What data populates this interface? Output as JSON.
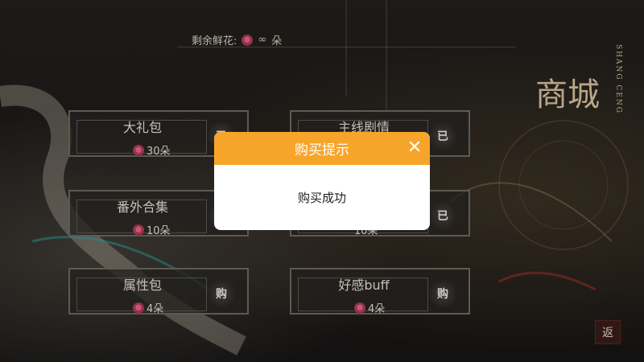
{
  "header": {
    "remaining_label": "剩余鲜花:",
    "remaining_value": "∞",
    "unit": "朵",
    "flower_icon": "flower-icon"
  },
  "logo": {
    "main": "商城",
    "sub": "SHANG CENG"
  },
  "items": [
    {
      "name": "大礼包",
      "price": "30朵",
      "button": "已"
    },
    {
      "name": "主线剧情",
      "price": "",
      "button": "已"
    },
    {
      "name": "番外合集",
      "price": "10朵",
      "button": ""
    },
    {
      "name": "",
      "price": "10朵",
      "button": "已"
    },
    {
      "name": "属性包",
      "price": "4朵",
      "button": "购"
    },
    {
      "name": "好感buff",
      "price": "4朵",
      "button": "购"
    }
  ],
  "back_button": "返",
  "dialog": {
    "title": "购买提示",
    "close_icon": "close-icon",
    "message": "购买成功"
  },
  "colors": {
    "dialog_header": "#f7a52a",
    "back_button": "#3a1d18"
  }
}
